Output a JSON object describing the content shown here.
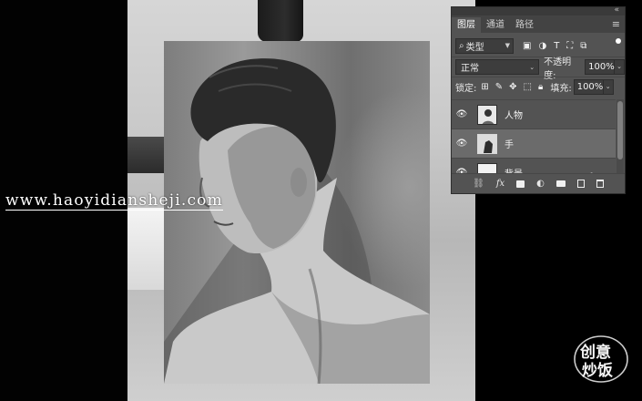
{
  "canvas": {
    "watermark_url": "www.haoyidiansheji.com",
    "brand_logo_text": "创意炒饭"
  },
  "layers_panel": {
    "collapse_glyph": "«",
    "tabs": [
      {
        "label": "图层",
        "active": true
      },
      {
        "label": "通道",
        "active": false
      },
      {
        "label": "路径",
        "active": false
      }
    ],
    "menu_glyph": "≡",
    "filter": {
      "label": "类型",
      "icons": [
        "image-filter-icon",
        "adjustment-filter-icon",
        "type-filter-icon",
        "shape-filter-icon",
        "smart-object-filter-icon"
      ]
    },
    "blend_mode": "正常",
    "opacity_label": "不透明度:",
    "opacity_value": "100%",
    "lock_label": "锁定:",
    "lock_icons": [
      "lock-pixels-icon",
      "lock-paint-icon",
      "lock-position-icon",
      "lock-artboard-icon",
      "lock-all-icon"
    ],
    "fill_label": "填充:",
    "fill_value": "100%",
    "layers": [
      {
        "name": "人物",
        "visible": true,
        "selected": false,
        "locked": false
      },
      {
        "name": "手",
        "visible": true,
        "selected": true,
        "locked": false
      },
      {
        "name": "背景",
        "visible": true,
        "selected": false,
        "locked": true
      }
    ],
    "bottom_icons": [
      "link-layers-icon",
      "fx-icon",
      "add-mask-icon",
      "adjustment-layer-icon",
      "new-group-icon",
      "new-layer-icon",
      "delete-layer-icon"
    ],
    "colors": {
      "panel_bg": "#535353",
      "selected_layer": "#6b6b6b",
      "tab_bar": "#434343"
    }
  }
}
